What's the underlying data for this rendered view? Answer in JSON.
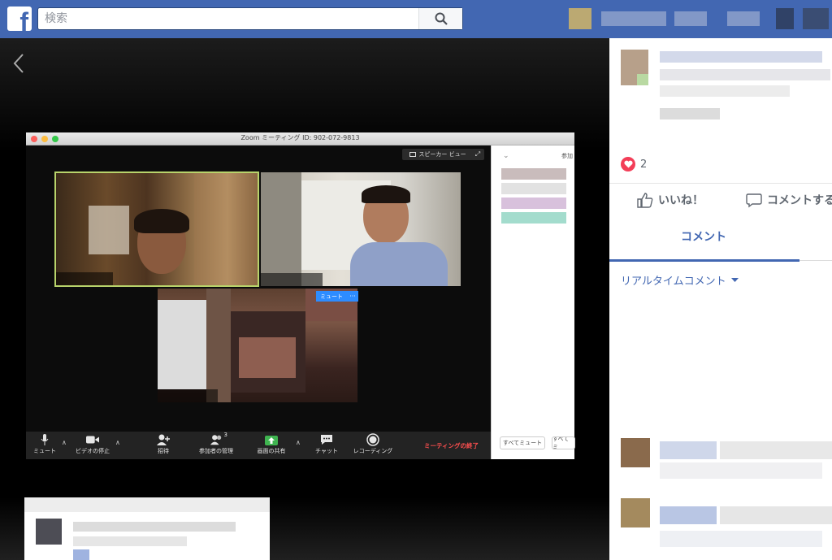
{
  "header": {
    "logo": "f",
    "search_placeholder": "検索"
  },
  "zoom": {
    "window_title": "Zoom ミーティング ID: 902-072-9813",
    "speaker_view_label": "スピーカー ビュー",
    "mute_badge": "ミュート",
    "more_badge": "···",
    "sidebar_label": "参加",
    "sidebar_mute_all": "すべてミュート",
    "sidebar_unmute_all": "すべてミ",
    "toolbar": {
      "mute": "ミュート",
      "stop_video": "ビデオの停止",
      "invite": "招待",
      "manage_participants": "参加者の管理",
      "participant_count": "3",
      "share_screen": "画面の共有",
      "chat": "チャット",
      "record": "レコーディング",
      "end_meeting": "ミーティングの終了"
    }
  },
  "post": {
    "reaction_count": "2",
    "like_label": "いいね！",
    "comment_label": "コメントする",
    "tab_comment": "コメント",
    "realtime_comments": "リアルタイムコメント"
  },
  "colors": {
    "fb_blue": "#4267b2",
    "heart_red": "#f33e58",
    "zoom_blue": "#2d8cff",
    "end_red": "#ff4f4f",
    "active_speaker": "#b8d36b"
  }
}
